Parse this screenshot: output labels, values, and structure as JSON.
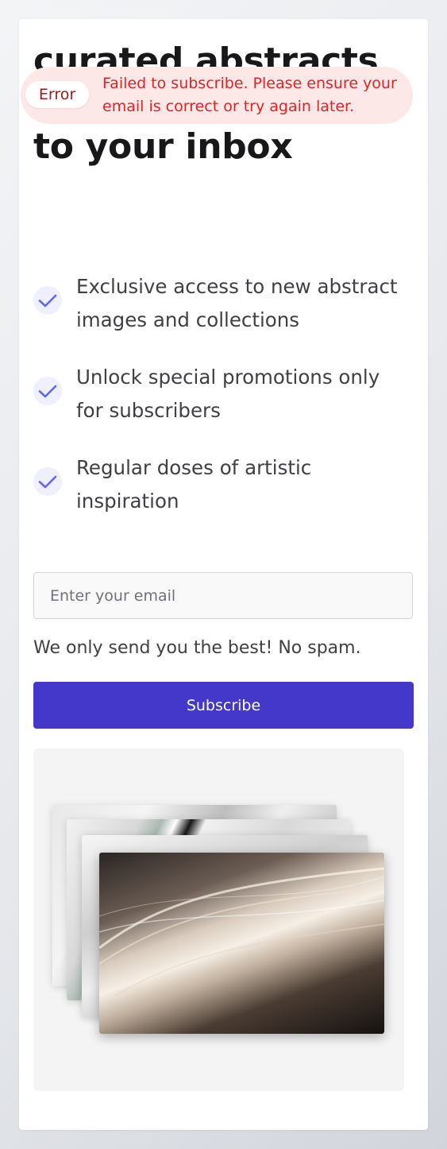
{
  "heading": "curated abstracts delivered weekly to your inbox",
  "toast": {
    "badge": "Error",
    "message": "Failed to subscribe. Please ensure your email is correct or try again later."
  },
  "features": [
    {
      "text": "Exclusive access to new abstract images and collections",
      "icon": "check-icon"
    },
    {
      "text": "Unlock special promotions only for subscribers",
      "icon": "check-icon"
    },
    {
      "text": "Regular doses of artistic inspiration",
      "icon": "check-icon"
    }
  ],
  "form": {
    "email_placeholder": "Enter your email",
    "email_value": "",
    "note": "We only send you the best! No spam.",
    "subscribe_label": "Subscribe"
  },
  "colors": {
    "accent": "#4338ca",
    "error_text": "#dc2626",
    "error_bg": "#fde8e8",
    "check": "#6366f1"
  }
}
